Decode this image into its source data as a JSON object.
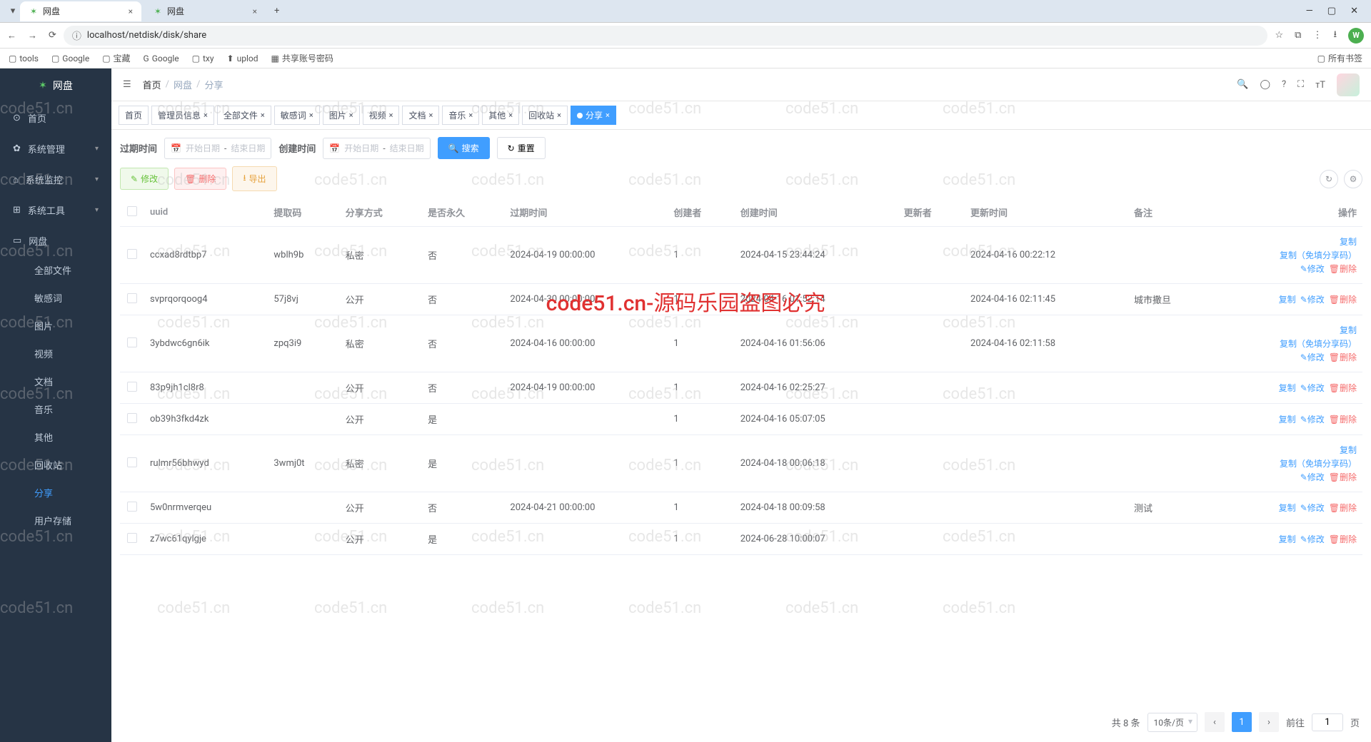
{
  "browser": {
    "tabs": [
      {
        "title": "网盘",
        "active": true
      },
      {
        "title": "网盘",
        "active": false
      }
    ],
    "url": "localhost/netdisk/disk/share",
    "bookmarks": [
      "tools",
      "Google",
      "宝藏",
      "Google",
      "txy",
      "uplod",
      "共享账号密码"
    ],
    "all_bookmarks": "所有书签",
    "avatar_letter": "W"
  },
  "sidebar": {
    "brand": "网盘",
    "items": [
      {
        "icon": "⊙",
        "label": "首页"
      },
      {
        "icon": "✿",
        "label": "系统管理",
        "arrow": true
      },
      {
        "icon": "⌂",
        "label": "系统监控",
        "arrow": true
      },
      {
        "icon": "⊞",
        "label": "系统工具",
        "arrow": true
      },
      {
        "icon": "▭",
        "label": "网盘",
        "open": true,
        "children": [
          {
            "label": "全部文件"
          },
          {
            "label": "敏感词"
          },
          {
            "label": "图片"
          },
          {
            "label": "视频"
          },
          {
            "label": "文档"
          },
          {
            "label": "音乐"
          },
          {
            "label": "其他"
          },
          {
            "label": "回收站"
          },
          {
            "label": "分享",
            "active": true
          },
          {
            "label": "用户存储"
          }
        ]
      }
    ]
  },
  "header": {
    "breadcrumb": [
      "首页",
      "网盘",
      "分享"
    ]
  },
  "page_tabs": [
    "首页",
    "管理员信息",
    "全部文件",
    "敏感词",
    "图片",
    "视频",
    "文档",
    "音乐",
    "其他",
    "回收站",
    "分享"
  ],
  "page_tabs_active": "分享",
  "filters": {
    "expire_label": "过期时间",
    "create_label": "创建时间",
    "start_placeholder": "开始日期",
    "end_placeholder": "结束日期",
    "search": "搜索",
    "reset": "重置"
  },
  "actions": {
    "edit": "修改",
    "delete": "删除",
    "export": "导出",
    "copy": "复制",
    "copy_no_code": "复制（免填分享码）",
    "refresh": "↻",
    "settings": "⚙"
  },
  "columns": [
    "",
    "uuid",
    "提取码",
    "分享方式",
    "是否永久",
    "过期时间",
    "创建者",
    "创建时间",
    "更新者",
    "更新时间",
    "备注",
    "操作"
  ],
  "share_private": "私密",
  "share_public": "公开",
  "yes": "是",
  "no": "否",
  "rows": [
    {
      "uuid": "ccxad8rdtbp7",
      "code": "wblh9b",
      "mode": "私密",
      "perm": "否",
      "expire": "2024-04-19 00:00:00",
      "creator": "1",
      "ctime": "2024-04-15 23:44:24",
      "updater": "",
      "utime": "2024-04-16 00:22:12",
      "remark": "",
      "ops": "private"
    },
    {
      "uuid": "svprqorqoog4",
      "code": "57j8vj",
      "mode": "公开",
      "perm": "否",
      "expire": "2024-04-30 00:00:00",
      "creator": "1",
      "ctime": "2024-04-16 01:52:14",
      "updater": "",
      "utime": "2024-04-16 02:11:45",
      "remark": "城市撒旦",
      "ops": "public"
    },
    {
      "uuid": "3ybdwc6gn6ik",
      "code": "zpq3i9",
      "mode": "私密",
      "perm": "否",
      "expire": "2024-04-16 00:00:00",
      "creator": "1",
      "ctime": "2024-04-16 01:56:06",
      "updater": "",
      "utime": "2024-04-16 02:11:58",
      "remark": "",
      "ops": "private"
    },
    {
      "uuid": "83p9jh1cl8r8",
      "code": "",
      "mode": "公开",
      "perm": "否",
      "expire": "2024-04-19 00:00:00",
      "creator": "1",
      "ctime": "2024-04-16 02:25:27",
      "updater": "",
      "utime": "",
      "remark": "",
      "ops": "public"
    },
    {
      "uuid": "ob39h3fkd4zk",
      "code": "",
      "mode": "公开",
      "perm": "是",
      "expire": "",
      "creator": "1",
      "ctime": "2024-04-16 05:07:05",
      "updater": "",
      "utime": "",
      "remark": "",
      "ops": "public"
    },
    {
      "uuid": "rulmr56bhwyd",
      "code": "3wmj0t",
      "mode": "私密",
      "perm": "是",
      "expire": "",
      "creator": "1",
      "ctime": "2024-04-18 00:06:18",
      "updater": "",
      "utime": "",
      "remark": "",
      "ops": "private"
    },
    {
      "uuid": "5w0nrmverqeu",
      "code": "",
      "mode": "公开",
      "perm": "否",
      "expire": "2024-04-21 00:00:00",
      "creator": "1",
      "ctime": "2024-04-18 00:09:58",
      "updater": "",
      "utime": "",
      "remark": "测试",
      "ops": "public"
    },
    {
      "uuid": "z7wc61qylgje",
      "code": "",
      "mode": "公开",
      "perm": "是",
      "expire": "",
      "creator": "1",
      "ctime": "2024-06-28 10:00:07",
      "updater": "",
      "utime": "",
      "remark": "",
      "ops": "public"
    }
  ],
  "pagination": {
    "total_text": "共 8 条",
    "page_size": "10条/页",
    "current": "1",
    "goto": "前往",
    "page_suffix": "页"
  },
  "watermark": "code51.cn",
  "watermark_red": "code51.cn-源码乐园盗图必究"
}
